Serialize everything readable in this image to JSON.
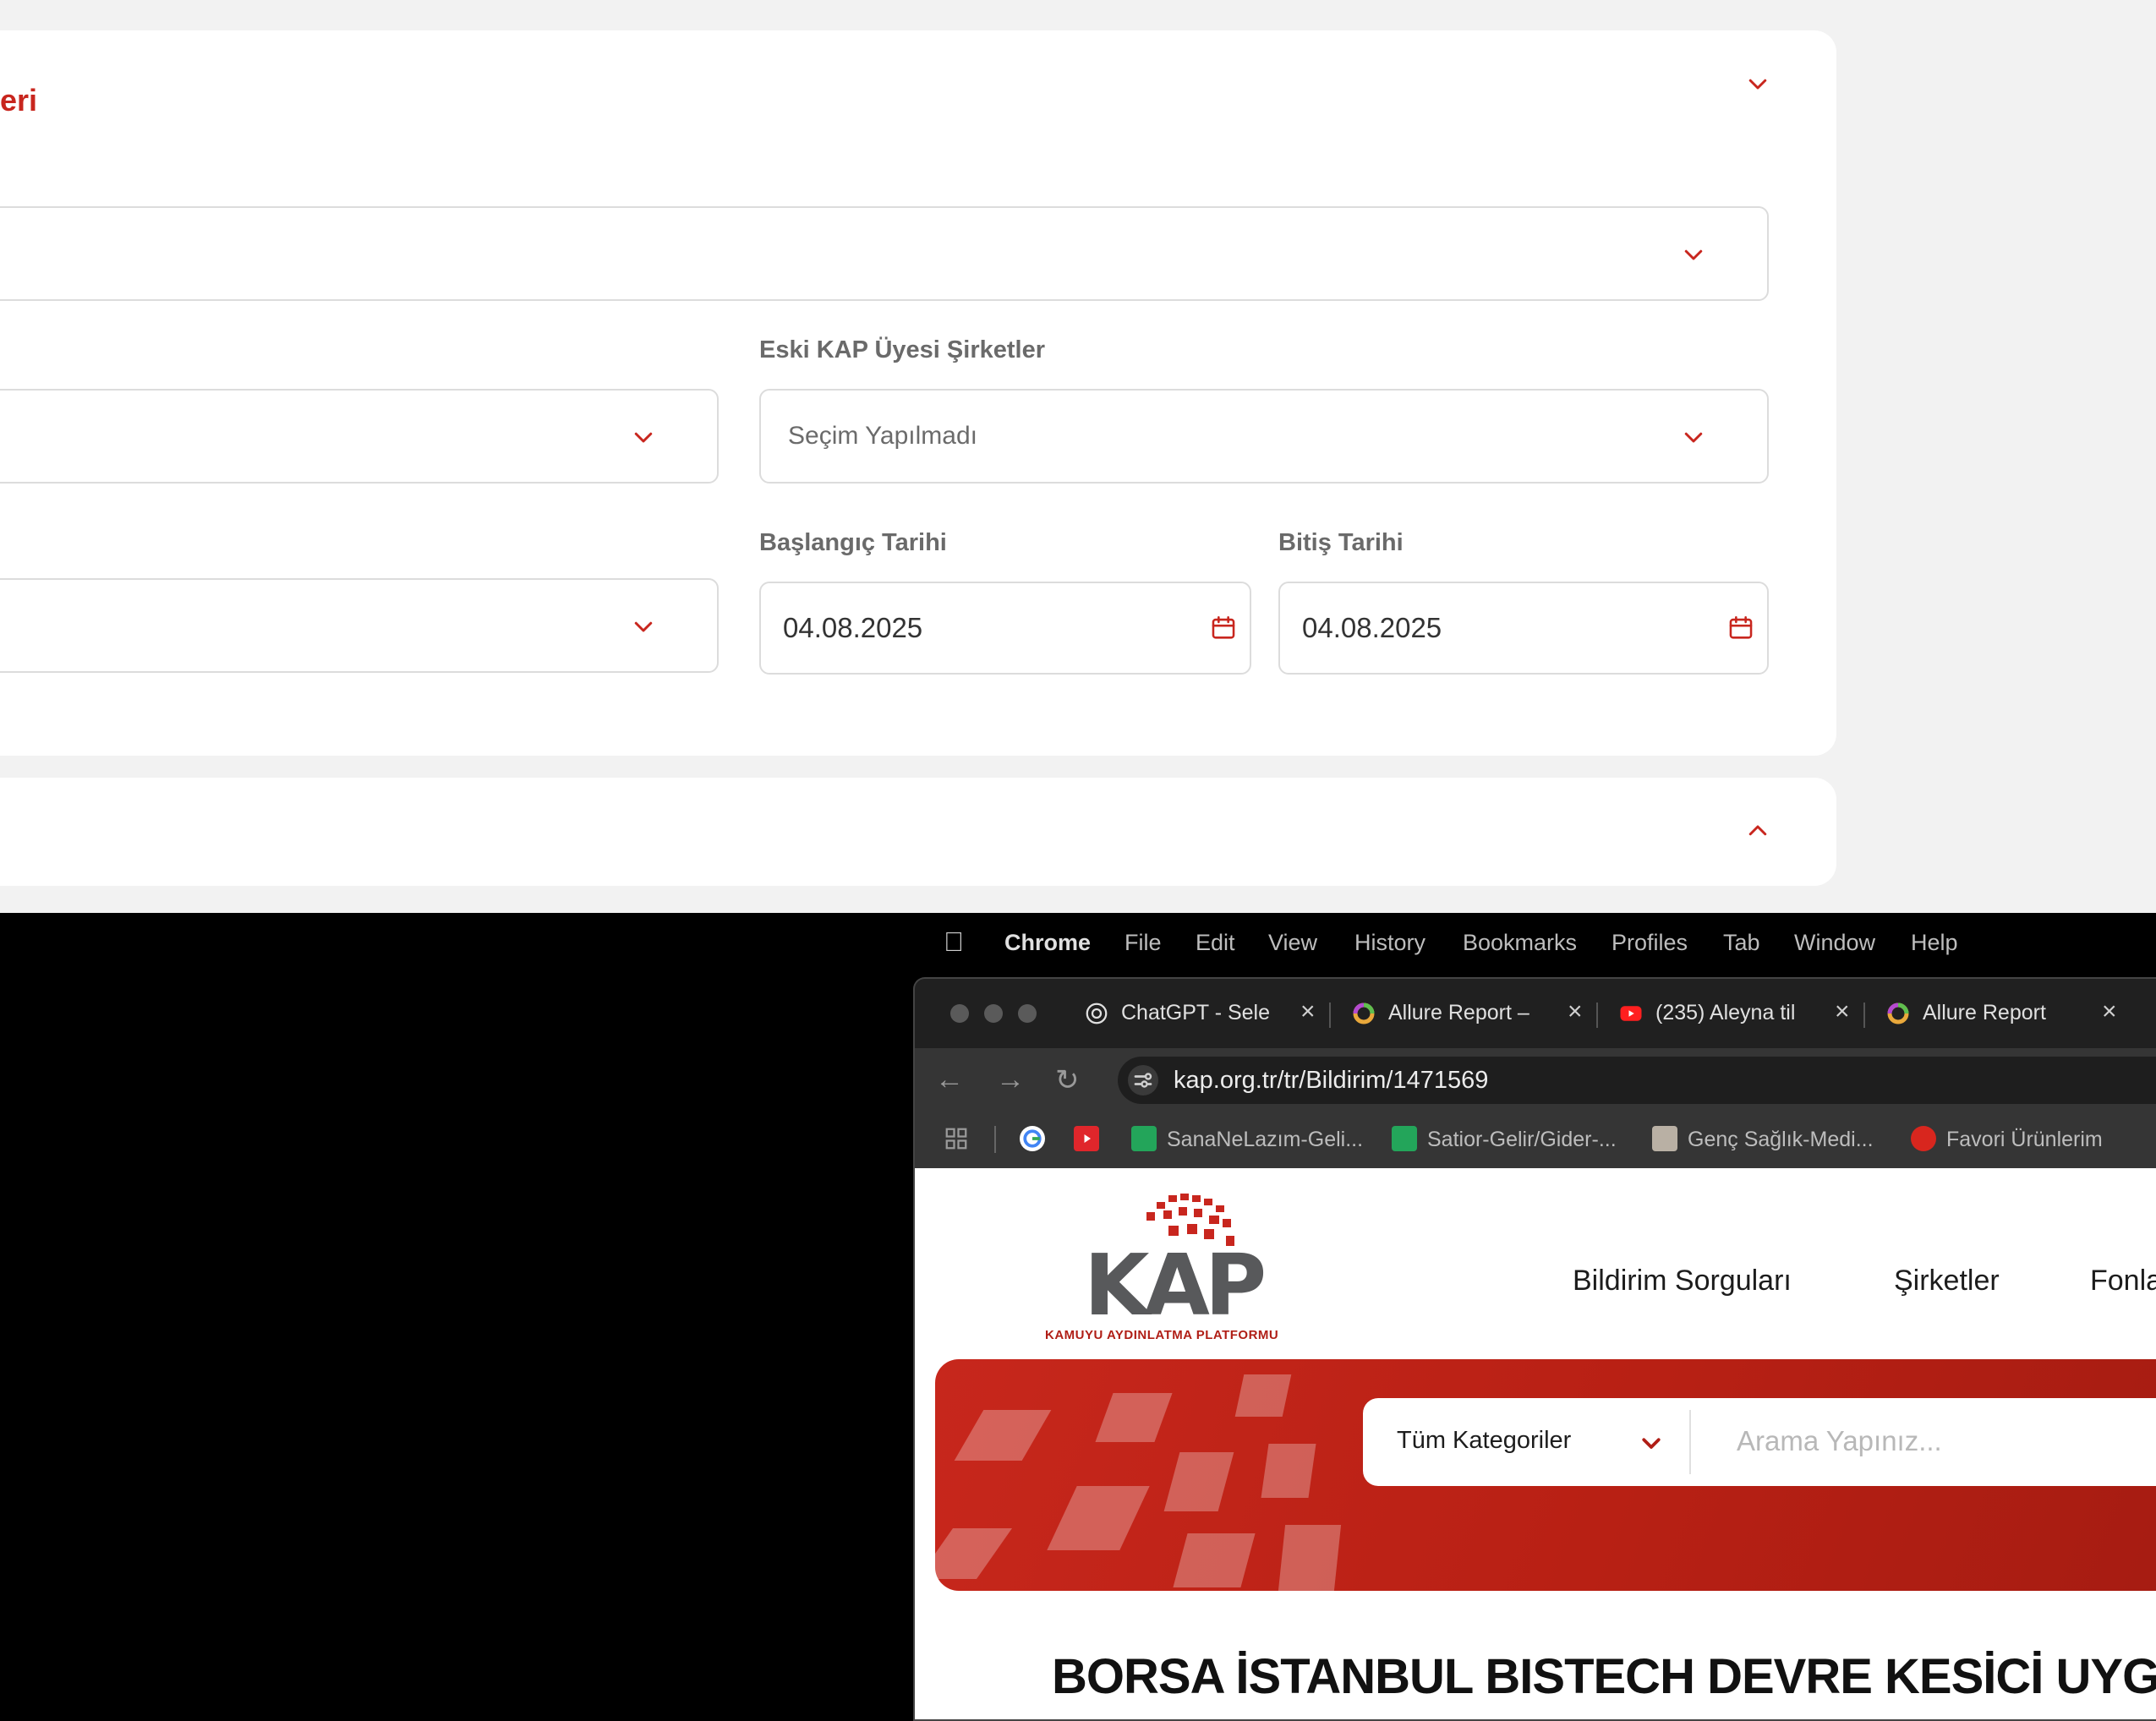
{
  "form": {
    "section_title": "eri",
    "field_old_members_label": "Eski KAP Üyesi Şirketler",
    "field_old_members_value": "Seçim Yapılmadı",
    "start_date_label": "Başlangıç Tarihi",
    "start_date_value": "04.08.2025",
    "end_date_label": "Bitiş Tarihi",
    "end_date_value": "04.08.2025"
  },
  "menubar": {
    "app": "Chrome",
    "items": [
      "File",
      "Edit",
      "View",
      "History",
      "Bookmarks",
      "Profiles",
      "Tab",
      "Window",
      "Help"
    ]
  },
  "tabs": [
    {
      "title": "ChatGPT - Sele",
      "icon": "chatgpt-icon"
    },
    {
      "title": "Allure Report –",
      "icon": "allure-icon"
    },
    {
      "title": "(235) Aleyna til",
      "icon": "youtube-icon"
    },
    {
      "title": "Allure Report",
      "icon": "allure-icon"
    }
  ],
  "address": {
    "url": "kap.org.tr/tr/Bildirim/1471569"
  },
  "bookmarks": [
    "SanaNeLazım-Geli...",
    "Satior-Gelir/Gider-...",
    "Genç Sağlık-Medi...",
    "Favori Ürünlerim"
  ],
  "site": {
    "logo_text": "KAP",
    "logo_subtitle": "KAMUYU AYDINLATMA PLATFORMU",
    "nav": [
      "Bildirim Sorguları",
      "Şirketler",
      "Fonla"
    ],
    "search_category": "Tüm Kategoriler",
    "search_placeholder": "Arama Yapınız...",
    "headline": "BORSA İSTANBUL BISTECH DEVRE KESİCİ UYGULA"
  },
  "colors": {
    "accent": "#c8261e",
    "hero_red": "#c7271c"
  }
}
